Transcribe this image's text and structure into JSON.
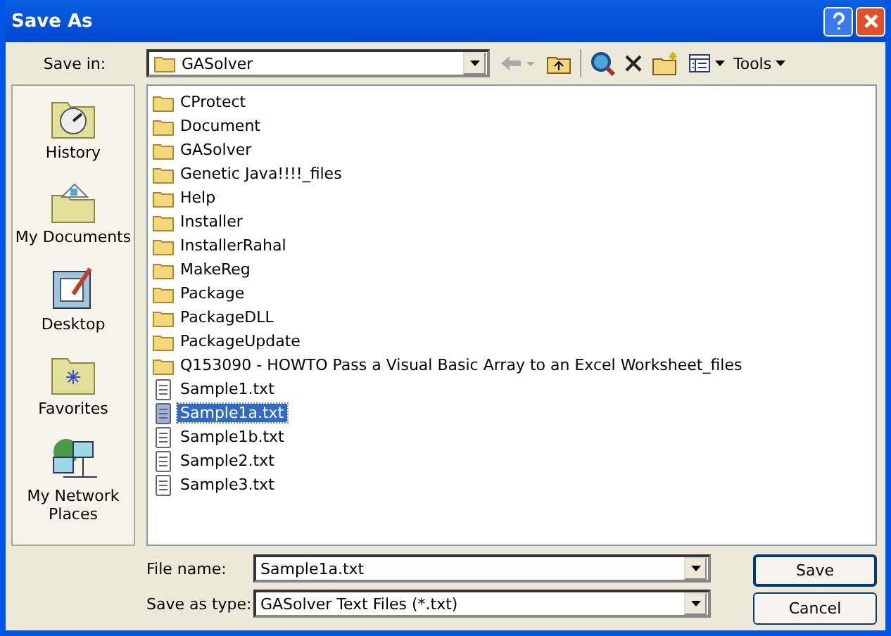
{
  "window": {
    "title": "Save As"
  },
  "toolbar": {
    "save_in_label": "Save in:",
    "location": "GASolver",
    "tools_label": "Tools"
  },
  "places": [
    {
      "kind": "history",
      "label": "History"
    },
    {
      "kind": "documents",
      "label": "My Documents"
    },
    {
      "kind": "desktop",
      "label": "Desktop"
    },
    {
      "kind": "favorites",
      "label": "Favorites"
    },
    {
      "kind": "network",
      "label": "My Network Places"
    }
  ],
  "files": [
    {
      "kind": "folder",
      "name": "CProtect",
      "selected": false
    },
    {
      "kind": "folder",
      "name": "Document",
      "selected": false
    },
    {
      "kind": "folder",
      "name": "GASolver",
      "selected": false
    },
    {
      "kind": "folder",
      "name": "Genetic Java!!!!_files",
      "selected": false
    },
    {
      "kind": "folder",
      "name": "Help",
      "selected": false
    },
    {
      "kind": "folder",
      "name": "Installer",
      "selected": false
    },
    {
      "kind": "folder",
      "name": "InstallerRahal",
      "selected": false
    },
    {
      "kind": "folder",
      "name": "MakeReg",
      "selected": false
    },
    {
      "kind": "folder",
      "name": "Package",
      "selected": false
    },
    {
      "kind": "folder",
      "name": "PackageDLL",
      "selected": false
    },
    {
      "kind": "folder",
      "name": "PackageUpdate",
      "selected": false
    },
    {
      "kind": "folder",
      "name": "Q153090 - HOWTO Pass a Visual Basic Array to an Excel Worksheet_files",
      "selected": false
    },
    {
      "kind": "file",
      "name": "Sample1.txt",
      "selected": false
    },
    {
      "kind": "file",
      "name": "Sample1a.txt",
      "selected": true
    },
    {
      "kind": "file",
      "name": "Sample1b.txt",
      "selected": false
    },
    {
      "kind": "file",
      "name": "Sample2.txt",
      "selected": false
    },
    {
      "kind": "file",
      "name": "Sample3.txt",
      "selected": false
    }
  ],
  "file_name": {
    "label": "File name:",
    "value": "Sample1a.txt"
  },
  "save_as_type": {
    "label": "Save as type:",
    "value": "GASolver Text Files (*.txt)"
  },
  "buttons": {
    "save": "Save",
    "cancel": "Cancel"
  }
}
